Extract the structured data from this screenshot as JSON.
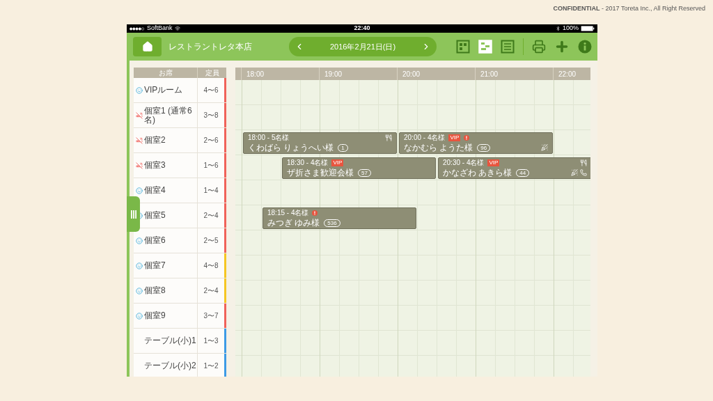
{
  "footer_note": "**CONFIDENTIAL** - 2017 Toreta Inc., All Right Reserved",
  "status_bar": {
    "carrier": "SoftBank",
    "time": "22:40",
    "battery": "100%"
  },
  "header": {
    "store_name": "レストラントレタ本店",
    "date": "2016年2月21日(日)",
    "views": [
      {
        "selected": false
      },
      {
        "selected": true
      },
      {
        "selected": false
      }
    ]
  },
  "seat_table": {
    "columns": [
      "お席",
      "定員"
    ],
    "rows": [
      {
        "name": "VIPルーム",
        "capacity": "4〜6",
        "smoking": true,
        "color": "#f0625a"
      },
      {
        "name": "個室1 (通常6名)",
        "capacity": "3〜8",
        "smoking": false,
        "color": "#f0625a"
      },
      {
        "name": "個室2",
        "capacity": "2〜6",
        "smoking": false,
        "color": "#f0625a",
        "reservations": [
          {
            "info": "18:00 - 5名様",
            "alert": false,
            "guest": "くわばら りょうへい様",
            "count": "1",
            "meal": true,
            "party": false,
            "phone": false
          },
          {
            "info": "20:00 - 4名様",
            "badge": "VIP",
            "alert": true,
            "guest": "なかむら ようた様",
            "count": "96",
            "meal": false,
            "party": true,
            "phone": false
          }
        ]
      },
      {
        "name": "個室3",
        "capacity": "1〜6",
        "smoking": false,
        "color": "#f0625a",
        "reservations": [
          {
            "info": "18:30 - 4名様",
            "badge": "VIP",
            "alert": false,
            "guest": "ザ折さま歓迎会様",
            "count": "57",
            "meal": false,
            "party": false,
            "phone": false
          },
          {
            "info": "20:30 - 4名様",
            "badge": "VIP",
            "alert": false,
            "guest": "かなざわ あきら様",
            "count": "44",
            "meal": true,
            "party": true,
            "phone": true
          }
        ]
      },
      {
        "name": "個室4",
        "capacity": "1〜4",
        "smoking": true,
        "color": "#f0625a"
      },
      {
        "name": "個室5",
        "capacity": "2〜4",
        "smoking": true,
        "color": "#f0625a",
        "reservations": [
          {
            "info": "18:15 - 4名様",
            "alert": true,
            "guest": "みつぎ ゆみ様",
            "count": "536",
            "meal": false,
            "party": false,
            "phone": false
          }
        ]
      },
      {
        "name": "個室6",
        "capacity": "2〜5",
        "smoking": true,
        "color": "#f0625a"
      },
      {
        "name": "個室7",
        "capacity": "4〜8",
        "smoking": true,
        "color": "#f5c623"
      },
      {
        "name": "個室8",
        "capacity": "2〜4",
        "smoking": true,
        "color": "#f5c623"
      },
      {
        "name": "個室9",
        "capacity": "3〜7",
        "smoking": true,
        "color": "#f0625a"
      },
      {
        "name": "テーブル(小)1",
        "capacity": "1〜3",
        "color": "#3d9be6"
      },
      {
        "name": "テーブル(小)2",
        "capacity": "1〜2",
        "color": "#3d9be6"
      }
    ]
  },
  "timeline": {
    "hours": [
      "18:00",
      "19:00",
      "20:00",
      "21:00",
      "22:00"
    ]
  }
}
